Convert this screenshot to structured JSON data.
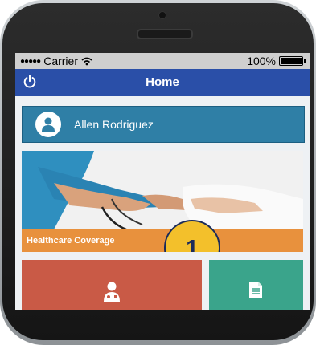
{
  "status_bar": {
    "signal_dots": "●●●●●",
    "carrier": "Carrier",
    "battery": "100%"
  },
  "navbar": {
    "title": "Home",
    "power_icon": "power-icon"
  },
  "profile": {
    "name": "Allen Rodriguez",
    "avatar_icon": "user-icon"
  },
  "hero": {
    "caption": "Healthcare Coverage",
    "badge_number": "1"
  },
  "tiles": [
    {
      "icon": "doctor-icon",
      "color": "#c95a46"
    },
    {
      "icon": "document-icon",
      "color": "#3aa48b"
    }
  ],
  "colors": {
    "navbar": "#2a4fa8",
    "profile_bar": "#2f7fa6",
    "caption_bar": "#e8913d",
    "badge": "#f3c02b"
  }
}
